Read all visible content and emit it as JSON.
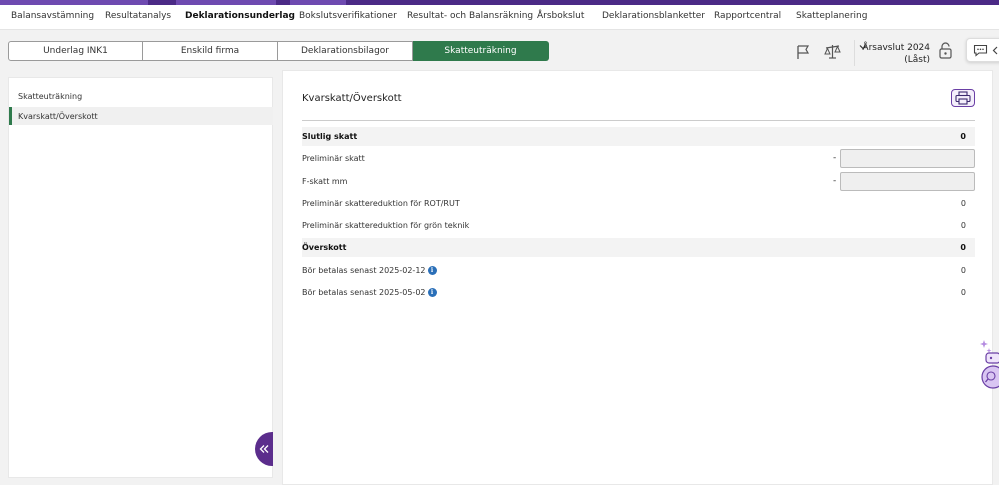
{
  "top_nav": [
    {
      "label": "Balansavstämning"
    },
    {
      "label": "Resultatanalys"
    },
    {
      "label": "Deklarationsunderlag",
      "active": true
    },
    {
      "label": "Bokslutsverifikationer"
    },
    {
      "label": "Resultat- och Balansräkning"
    },
    {
      "label": "Årsbokslut"
    },
    {
      "label": "Deklarationsblanketter"
    },
    {
      "label": "Rapportcentral"
    },
    {
      "label": "Skatteplanering"
    }
  ],
  "sub_tabs": [
    {
      "label": "Underlag INK1"
    },
    {
      "label": "Enskild firma"
    },
    {
      "label": "Deklarationsbilagor"
    },
    {
      "label": "Skatteuträkning",
      "active": true
    }
  ],
  "toolbar": {
    "icons": [
      "flag-icon",
      "balance-scale-icon",
      "lock-icon",
      "chat-icon"
    ],
    "year_line1": "Årsavslut 2024",
    "year_line2": "(Låst)"
  },
  "sidebar": {
    "items": [
      {
        "label": "Skatteuträkning"
      },
      {
        "label": "Kvarskatt/Överskott",
        "active": true
      }
    ]
  },
  "main": {
    "title": "Kvarskatt/Överskott",
    "rows": [
      {
        "label": "Slutlig skatt",
        "value": "0"
      },
      {
        "label": "Preliminär skatt",
        "dash": "-",
        "input_value": ""
      },
      {
        "label": "F-skatt mm",
        "dash": "-",
        "input_value": ""
      },
      {
        "label": "Preliminär skattereduktion för ROT/RUT",
        "value": "0"
      },
      {
        "label": "Preliminär skattereduktion för grön teknik",
        "value": "0"
      },
      {
        "label": "Överskott",
        "value": "0"
      },
      {
        "label": "Bör betalas senast 2025-02-12",
        "value": "0"
      },
      {
        "label": "Bör betalas senast 2025-05-02",
        "value": "0"
      }
    ]
  },
  "colors": {
    "brand_purple": "#4b2a86",
    "active_green": "#2f7a4c",
    "info_blue": "#2a6fb8"
  }
}
